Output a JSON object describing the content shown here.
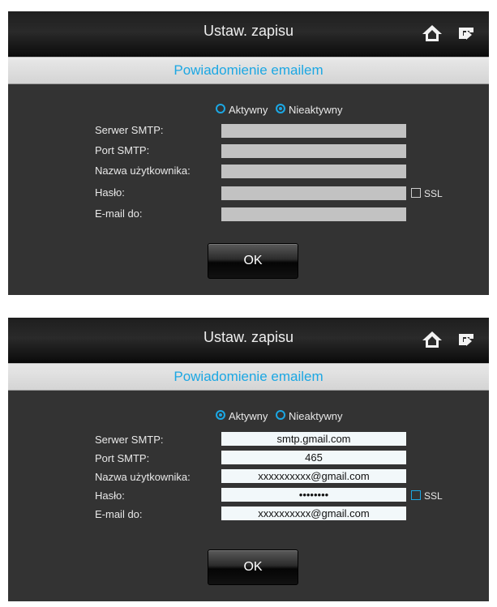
{
  "screens": [
    {
      "title": "Ustaw. zapisu",
      "subtitle": "Powiadomienie emailem",
      "radio_active": "Aktywny",
      "radio_inactive": "Nieaktywny",
      "selected": "Nieaktywny",
      "labels": {
        "smtp_server": "Serwer SMTP:",
        "smtp_port": "Port SMTP:",
        "username": "Nazwa użytkownika:",
        "password": "Hasło:",
        "email_to": "E-mail do:"
      },
      "values": {
        "smtp_server": "",
        "smtp_port": "",
        "username": "",
        "password": "",
        "email_to": ""
      },
      "ssl_label": "SSL",
      "ssl_checked": false,
      "ok_label": "OK"
    },
    {
      "title": "Ustaw. zapisu",
      "subtitle": "Powiadomienie emailem",
      "radio_active": "Aktywny",
      "radio_inactive": "Nieaktywny",
      "selected": "Aktywny",
      "labels": {
        "smtp_server": "Serwer SMTP:",
        "smtp_port": "Port SMTP:",
        "username": "Nazwa użytkownika:",
        "password": "Hasło:",
        "email_to": "E-mail do:"
      },
      "values": {
        "smtp_server": "smtp.gmail.com",
        "smtp_port": "465",
        "username": "xxxxxxxxxx@gmail.com",
        "password": "••••••••",
        "email_to": "xxxxxxxxxx@gmail.com"
      },
      "ssl_label": "SSL",
      "ssl_checked": false,
      "ok_label": "OK"
    }
  ],
  "icons": {
    "home": "home-icon",
    "exit": "exit-icon"
  },
  "colors": {
    "accent": "#1ca7e3",
    "panel": "#333333",
    "header": "#1a1a1a"
  }
}
